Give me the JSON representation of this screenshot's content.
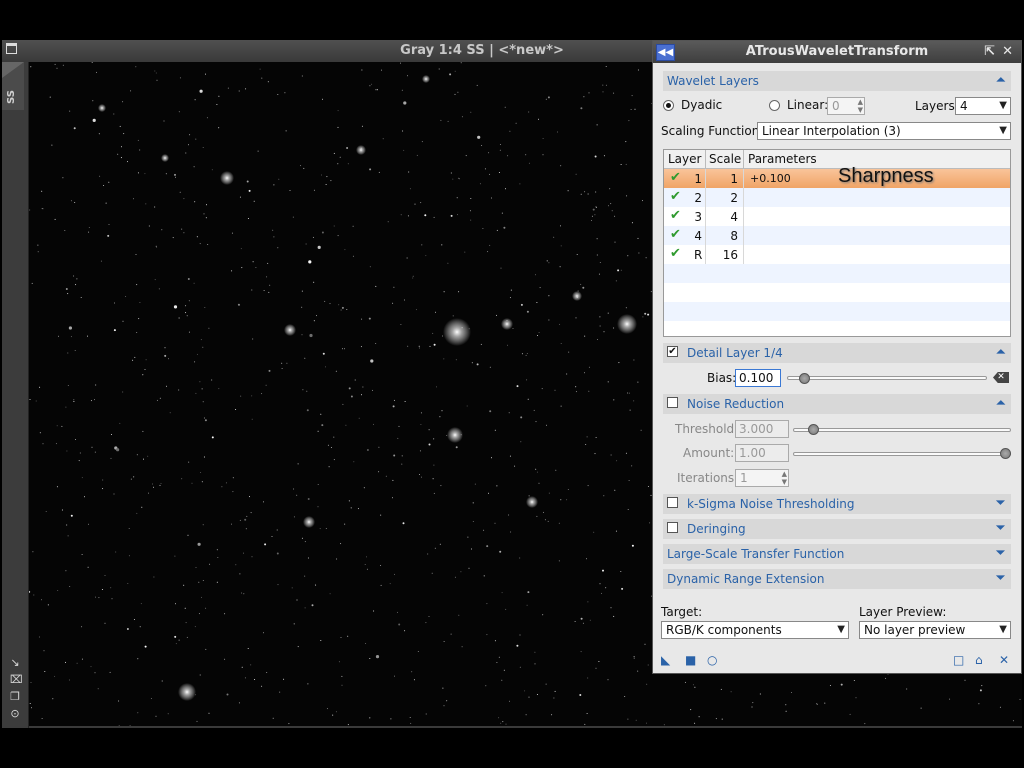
{
  "image_window": {
    "title": "Gray 1:4 SS | <*new*>",
    "side_tab": "SS",
    "side_icons": [
      "shrink-icon",
      "fit-icon",
      "copy-icon",
      "target-icon"
    ]
  },
  "dialog": {
    "title": "ATrousWaveletTransform",
    "sections": {
      "wavelet_layers": "Wavelet Layers",
      "detail_layer": "Detail Layer 1/4",
      "noise_reduction": "Noise Reduction",
      "k_sigma": "k-Sigma Noise Thresholding",
      "deringing": "Deringing",
      "large_scale": "Large-Scale Transfer Function",
      "dynamic_range": "Dynamic Range Extension"
    },
    "dyadic_label": "Dyadic",
    "linear_label": "Linear:",
    "linear_value": "0",
    "layers_label": "Layers:",
    "layers_value": "4",
    "scaling_label": "Scaling Function:",
    "scaling_value": "Linear Interpolation (3)",
    "table": {
      "headers": [
        "Layer",
        "Scale",
        "Parameters"
      ],
      "rows": [
        {
          "layer": "1",
          "scale": "1",
          "params": "+0.100"
        },
        {
          "layer": "2",
          "scale": "2",
          "params": ""
        },
        {
          "layer": "3",
          "scale": "4",
          "params": ""
        },
        {
          "layer": "4",
          "scale": "8",
          "params": ""
        },
        {
          "layer": "R",
          "scale": "16",
          "params": ""
        }
      ]
    },
    "annotation": "Sharpness",
    "bias_label": "Bias:",
    "bias_value": "0.100",
    "threshold_label": "Threshold:",
    "threshold_value": "3.000",
    "amount_label": "Amount:",
    "amount_value": "1.00",
    "iterations_label": "Iterations:",
    "iterations_value": "1",
    "target_label": "Target:",
    "target_value": "RGB/K components",
    "preview_label": "Layer Preview:",
    "preview_value": "No layer preview"
  },
  "colors": {
    "section_text": "#2a62a8",
    "selected_row": "#f0a466",
    "check": "#2f9a2f"
  }
}
